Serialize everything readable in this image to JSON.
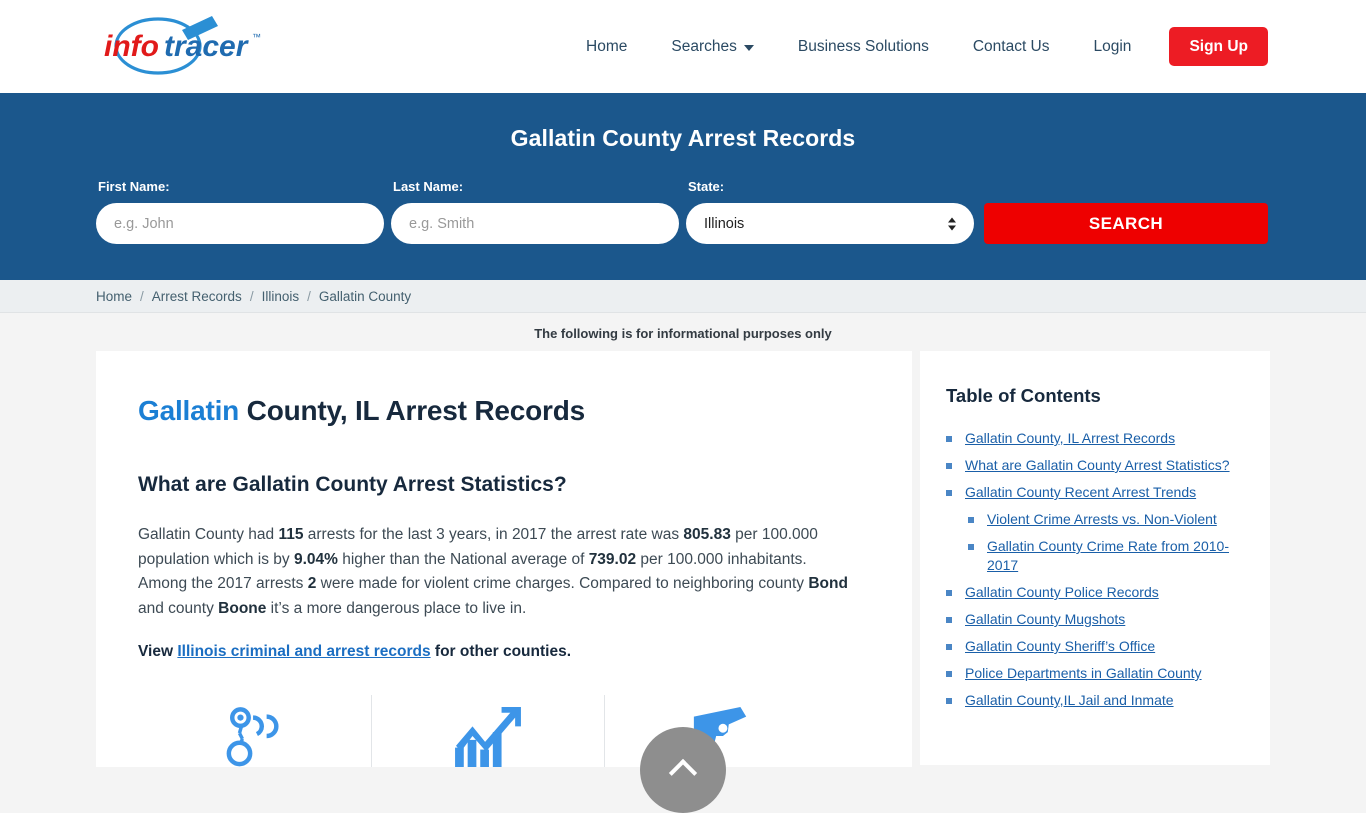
{
  "header": {
    "logo": {
      "name": "infotracer-logo",
      "text_primary": "info",
      "text_secondary": "tracer",
      "trademark": "™",
      "color_primary": "#e11a1a",
      "color_secondary": "#1f6bb0"
    },
    "nav": [
      {
        "label": "Home",
        "icon": null
      },
      {
        "label": "Searches",
        "icon": "chevron-down-icon"
      },
      {
        "label": "Business Solutions",
        "icon": null
      },
      {
        "label": "Contact Us",
        "icon": null
      },
      {
        "label": "Login",
        "icon": null
      }
    ],
    "signup_label": "Sign Up"
  },
  "banner": {
    "title": "Gallatin County Arrest Records",
    "background_color": "#1b578c",
    "first_name": {
      "label": "First Name:",
      "placeholder": "e.g. John",
      "value": ""
    },
    "last_name": {
      "label": "Last Name:",
      "placeholder": "e.g. Smith",
      "value": ""
    },
    "state": {
      "label": "State:",
      "value": "Illinois",
      "options": [
        "Illinois"
      ]
    },
    "search_button": {
      "label": "SEARCH",
      "color": "#ee0000"
    }
  },
  "breadcrumb": {
    "separator": "/",
    "items": [
      {
        "label": "Home",
        "current": false
      },
      {
        "label": "Arrest Records",
        "current": false
      },
      {
        "label": "Illinois",
        "current": false
      },
      {
        "label": "Gallatin County",
        "current": true
      }
    ]
  },
  "disclaimer": "The following is for informational purposes only",
  "main": {
    "h1_accent": "Gallatin",
    "h1_rest": " County, IL Arrest Records",
    "h2": "What are Gallatin County Arrest Statistics?",
    "paragraph": {
      "p1": "Gallatin County had ",
      "b1": "115",
      "p2": " arrests for the last 3 years, in 2017 the arrest rate was ",
      "b2": "805.83",
      "p3": " per 100.000 population which is by ",
      "b3": "9.04%",
      "p4": " higher than the National average of ",
      "b4": "739.02",
      "p5": " per 100.000 inhabitants. Among the 2017 arrests ",
      "b5": "2",
      "p6": " were made for violent crime charges. Compared to neighboring county ",
      "b6": "Bond",
      "p7": " and county ",
      "b7": "Boone",
      "p8": " it’s a more dangerous place to live in."
    },
    "view_line": {
      "prefix": "View ",
      "link": "Illinois criminal and arrest records",
      "suffix": " for other counties."
    },
    "icons": [
      {
        "name": "handcuffs-icon",
        "color": "#3d95e8"
      },
      {
        "name": "trending-chart-icon",
        "color": "#3d95e8"
      },
      {
        "name": "handgun-icon",
        "color": "#3d95e8"
      }
    ]
  },
  "toc": {
    "title": "Table of Contents",
    "items": [
      {
        "label": "Gallatin County, IL Arrest Records",
        "sub": false
      },
      {
        "label": "What are Gallatin County Arrest Statistics?",
        "sub": false
      },
      {
        "label": "Gallatin County Recent Arrest Trends",
        "sub": false
      },
      {
        "label": "Violent Crime Arrests vs. Non-Violent",
        "sub": true
      },
      {
        "label": "Gallatin County Crime Rate from 2010-2017",
        "sub": true
      },
      {
        "label": "Gallatin County Police Records",
        "sub": false
      },
      {
        "label": "Gallatin County Mugshots",
        "sub": false
      },
      {
        "label": "Gallatin County Sheriff’s Office",
        "sub": false
      },
      {
        "label": "Police Departments in Gallatin County",
        "sub": false
      },
      {
        "label": "Gallatin County,IL Jail and Inmate",
        "sub": false
      }
    ]
  },
  "scroll_top": {
    "name": "scroll-to-top-button",
    "icon": "chevron-up-icon",
    "color": "#8e8e8e"
  }
}
